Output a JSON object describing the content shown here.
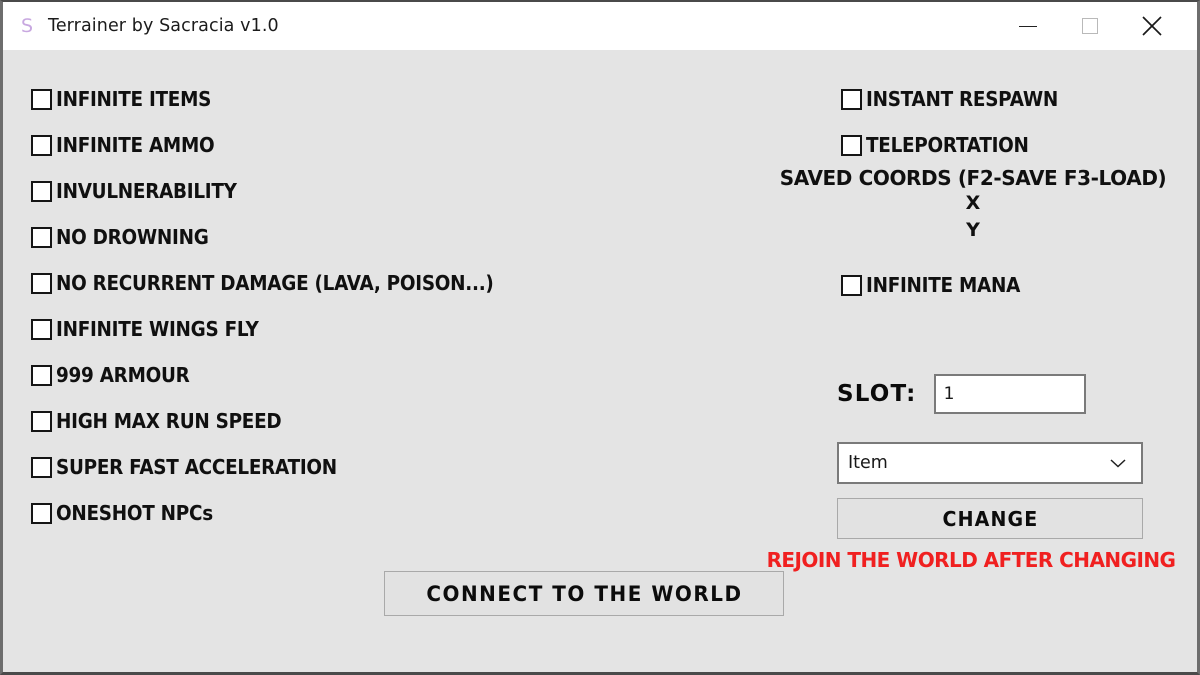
{
  "window": {
    "title": "Terrainer by Sacracia v1.0",
    "icon": "S",
    "icon_color": "#c8a8e0",
    "background_color": "#e4e4e4",
    "titlebar_color": "#ffffff",
    "controls": {
      "minimize": "minimize-icon",
      "maximize": "maximize-icon",
      "close": "close-icon"
    }
  },
  "left_column": {
    "checkboxes": [
      {
        "label": "INFINITE ITEMS",
        "checked": false
      },
      {
        "label": "INFINITE AMMO",
        "checked": false
      },
      {
        "label": "INVULNERABILITY",
        "checked": false
      },
      {
        "label": "NO DROWNING",
        "checked": false
      },
      {
        "label": "NO RECURRENT DAMAGE (LAVA, POISON...)",
        "checked": false
      },
      {
        "label": "INFINITE WINGS FLY",
        "checked": false
      },
      {
        "label": "999 ARMOUR",
        "checked": false
      },
      {
        "label": "HIGH MAX RUN SPEED",
        "checked": false
      },
      {
        "label": "SUPER FAST ACCELERATION",
        "checked": false
      },
      {
        "label": "ONESHOT NPCs",
        "checked": false
      }
    ]
  },
  "right_column": {
    "instant_respawn": {
      "label": "INSTANT RESPAWN",
      "checked": false
    },
    "teleportation": {
      "label": "TELEPORTATION",
      "checked": false
    },
    "saved_coords_header": "SAVED COORDS (F2-SAVE F3-LOAD)",
    "coord_x_label": "X",
    "coord_y_label": "Y",
    "infinite_mana": {
      "label": "INFINITE MANA",
      "checked": false
    },
    "slot": {
      "label": "SLOT:",
      "value": "1",
      "placeholder": ""
    },
    "type_select": {
      "selected": "Item",
      "icon": "chevron-down-icon"
    },
    "change_button": "CHANGE",
    "warning": {
      "text": "REJOIN THE WORLD AFTER CHANGING",
      "color": "#f02020"
    }
  },
  "footer": {
    "connect_button": "CONNECT TO THE WORLD"
  }
}
